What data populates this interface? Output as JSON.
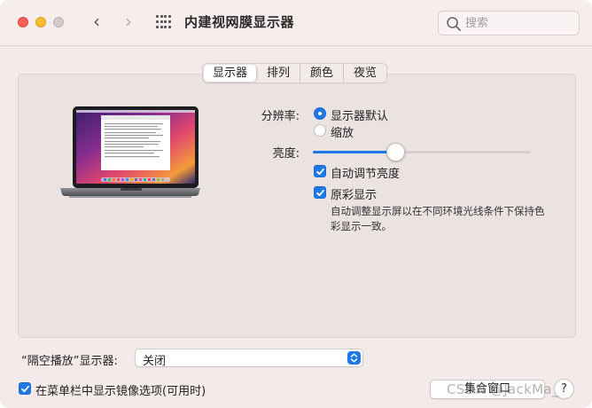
{
  "window": {
    "title": "内建视网膜显示器"
  },
  "toolbar": {
    "back_icon": "chevron-left-icon",
    "forward_icon": "chevron-right-icon",
    "grid_icon": "show-all-grid-icon"
  },
  "search": {
    "placeholder": "搜索"
  },
  "tabs": [
    {
      "label": "显示器",
      "active": true
    },
    {
      "label": "排列",
      "active": false
    },
    {
      "label": "颜色",
      "active": false
    },
    {
      "label": "夜览",
      "active": false
    }
  ],
  "resolution": {
    "label": "分辨率:",
    "options": [
      {
        "label": "显示器默认",
        "selected": true
      },
      {
        "label": "缩放",
        "selected": false
      }
    ]
  },
  "brightness": {
    "label": "亮度:",
    "level_percent": 38
  },
  "auto_brightness": {
    "label": "自动调节亮度",
    "checked": true
  },
  "true_tone": {
    "label": "原彩显示",
    "checked": true,
    "description": "自动调整显示屏以在不同环境光线条件下保持色彩显示一致。"
  },
  "airplay": {
    "label": "“隔空播放”显示器:",
    "value": "关闭"
  },
  "menu_bar_option": {
    "label": "在菜单栏中显示镜像选项(可用时)",
    "checked": true
  },
  "gather_button": {
    "label": "集合窗口"
  },
  "help_button": {
    "label": "?"
  },
  "watermark": {
    "text": "CSDN @JackMa_"
  },
  "colors": {
    "accent": "#1e78e6",
    "window_bg": "#f4eaea"
  }
}
